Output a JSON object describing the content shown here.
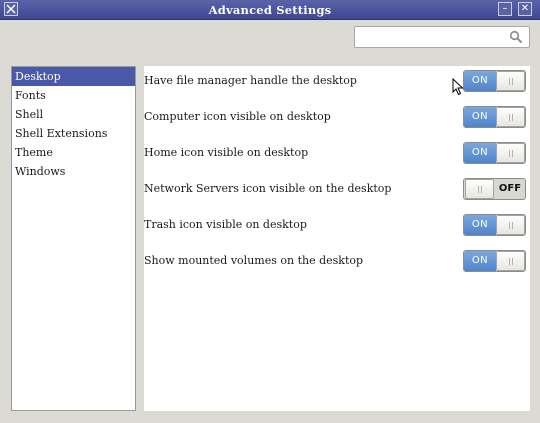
{
  "window": {
    "title": "Advanced Settings",
    "close_glyph": "✕",
    "min_glyph": "–"
  },
  "search": {
    "placeholder": "",
    "value": ""
  },
  "sidebar": {
    "items": [
      {
        "label": "Desktop",
        "selected": true
      },
      {
        "label": "Fonts",
        "selected": false
      },
      {
        "label": "Shell",
        "selected": false
      },
      {
        "label": "Shell Extensions",
        "selected": false
      },
      {
        "label": "Theme",
        "selected": false
      },
      {
        "label": "Windows",
        "selected": false
      }
    ]
  },
  "settings": [
    {
      "label": "Have file manager handle the desktop",
      "state": "ON"
    },
    {
      "label": "Computer icon visible on desktop",
      "state": "ON"
    },
    {
      "label": "Home icon visible on desktop",
      "state": "ON"
    },
    {
      "label": "Network Servers icon visible on the desktop",
      "state": "OFF"
    },
    {
      "label": "Trash icon visible on desktop",
      "state": "ON"
    },
    {
      "label": "Show mounted volumes on the desktop",
      "state": "ON"
    }
  ],
  "colors": {
    "titlebar": "#4a52a0",
    "selection": "#4a59a7",
    "toggle_on": "#5b8fd3"
  },
  "icons": [
    "app-icon",
    "minimize-icon",
    "close-icon",
    "search-icon",
    "mouse-cursor-icon"
  ]
}
